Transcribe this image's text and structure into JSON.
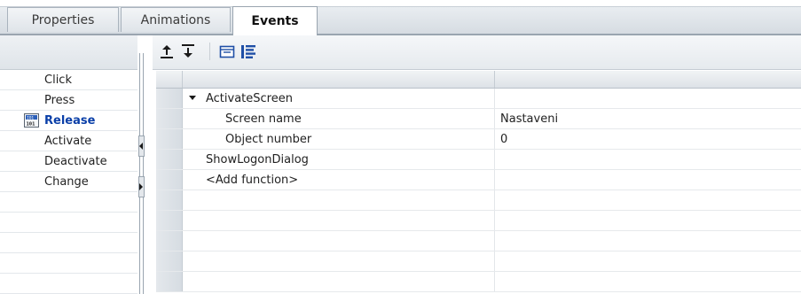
{
  "tabs": [
    {
      "label": "Properties",
      "active": false
    },
    {
      "label": "Animations",
      "active": false
    },
    {
      "label": "Events",
      "active": true
    }
  ],
  "events": [
    {
      "label": "Click",
      "selected": false
    },
    {
      "label": "Press",
      "selected": false
    },
    {
      "label": "Release",
      "selected": true,
      "icon": "release-event-icon"
    },
    {
      "label": "Activate",
      "selected": false
    },
    {
      "label": "Deactivate",
      "selected": false
    },
    {
      "label": "Change",
      "selected": false
    }
  ],
  "toolbar": {
    "buttons": [
      "move-up-icon",
      "move-down-icon",
      "folder-icon",
      "list-view-icon"
    ]
  },
  "function_list": {
    "rows": [
      {
        "name": "ActivateScreen",
        "expanded": true,
        "value": ""
      },
      {
        "name": "Screen name",
        "value": "Nastaveni"
      },
      {
        "name": "Object number",
        "value": "0"
      },
      {
        "name": "ShowLogonDialog",
        "value": ""
      },
      {
        "name": "<Add function>",
        "value": ""
      }
    ]
  },
  "colors": {
    "selected_text": "#0a3fa8",
    "panel_border": "#9aa5b0",
    "tab_strip": "#dfe4e9"
  }
}
